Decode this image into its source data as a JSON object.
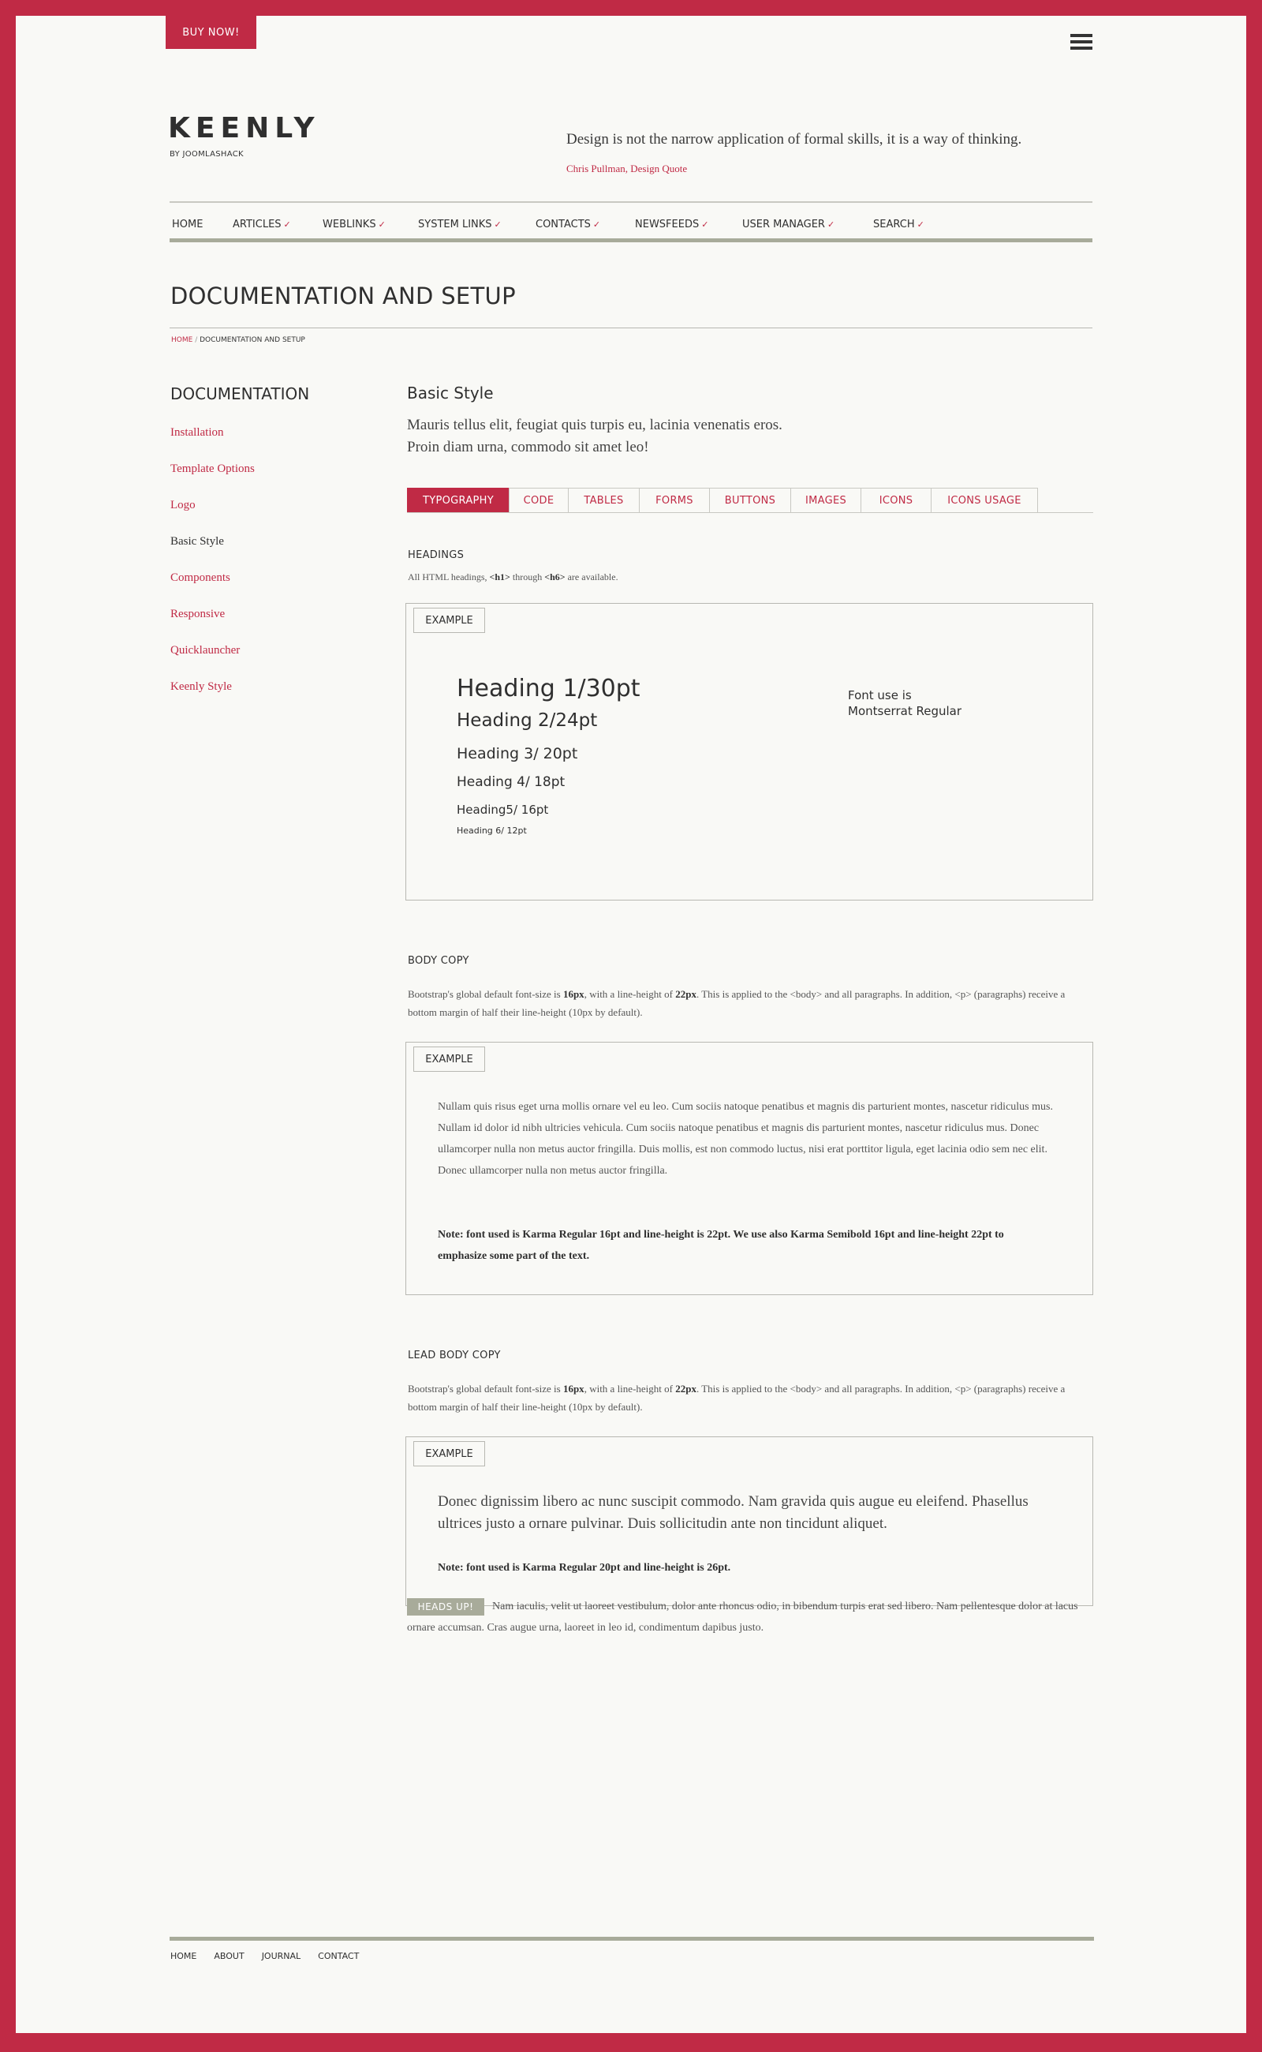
{
  "header": {
    "buy_label": "BUY NOW!",
    "logo": "KEENLY",
    "logo_sub": "BY JOOMLASHACK",
    "quote": "Design is not the narrow application of formal skills, it is a way of thinking.",
    "quote_author": "Chris Pullman, Design Quote"
  },
  "nav": {
    "items": [
      {
        "label": "HOME",
        "dropdown": false
      },
      {
        "label": "ARTICLES",
        "dropdown": true
      },
      {
        "label": "WEBLINKS",
        "dropdown": true
      },
      {
        "label": "SYSTEM LINKS",
        "dropdown": true
      },
      {
        "label": "CONTACTS",
        "dropdown": true
      },
      {
        "label": "NEWSFEEDS",
        "dropdown": true
      },
      {
        "label": "USER MANAGER",
        "dropdown": true
      },
      {
        "label": "SEARCH",
        "dropdown": true
      }
    ]
  },
  "page": {
    "title": "DOCUMENTATION AND SETUP",
    "breadcrumb_home": "HOME",
    "breadcrumb_sep": "/",
    "breadcrumb_current": "DOCUMENTATION AND SETUP"
  },
  "sidebar": {
    "title": "DOCUMENTATION",
    "items": [
      {
        "label": "Installation",
        "active": false
      },
      {
        "label": "Template Options",
        "active": false
      },
      {
        "label": "Logo",
        "active": false
      },
      {
        "label": "Basic Style",
        "active": true
      },
      {
        "label": "Components",
        "active": false
      },
      {
        "label": "Responsive",
        "active": false
      },
      {
        "label": "Quicklauncher",
        "active": false
      },
      {
        "label": "Keenly Style",
        "active": false
      }
    ]
  },
  "main": {
    "heading": "Basic Style",
    "lead_1": "Mauris tellus elit, feugiat quis turpis eu, lacinia venenatis eros.",
    "lead_2": "Proin diam urna, commodo sit amet leo!",
    "tabs": [
      {
        "label": "TYPOGRAPHY",
        "active": true
      },
      {
        "label": "CODE",
        "active": false
      },
      {
        "label": "TABLES",
        "active": false
      },
      {
        "label": "FORMS",
        "active": false
      },
      {
        "label": "BUTTONS",
        "active": false
      },
      {
        "label": "IMAGES",
        "active": false
      },
      {
        "label": "ICONS",
        "active": false
      },
      {
        "label": "ICONS USAGE",
        "active": false
      }
    ],
    "example_label": "EXAMPLE",
    "headings": {
      "label": "HEADINGS",
      "desc_pre": "All HTML headings, ",
      "desc_h1": "<h1>",
      "desc_mid": " through ",
      "desc_h6": "<h6>",
      "desc_post": " are available.",
      "samples": [
        "Heading 1/30pt",
        "Heading 2/24pt",
        "Heading 3/ 20pt",
        "Heading 4/ 18pt",
        "Heading5/ 16pt",
        "Heading 6/ 12pt"
      ],
      "font_note_1": "Font use is",
      "font_note_2": "Montserrat Regular"
    },
    "body_copy": {
      "label": "BODY COPY",
      "desc_1": "Bootstrap's global default font-size is ",
      "desc_16": "16px",
      "desc_2": ", with a line-height of ",
      "desc_22": "22px",
      "desc_3": ". This is applied to the <body> and all paragraphs. In addition, <p> (paragraphs) receive a bottom margin of half their line-height (10px by default).",
      "para": "Nullam quis risus eget urna mollis ornare vel eu leo. Cum sociis natoque penatibus et magnis dis parturient montes, nascetur ridiculus mus. Nullam id dolor id nibh ultricies vehicula. Cum sociis natoque penatibus et magnis dis parturient montes, nascetur ridiculus mus. Donec ullamcorper nulla non metus auctor fringilla. Duis mollis, est non commodo luctus, nisi erat porttitor ligula, eget lacinia odio sem nec elit. Donec ullamcorper nulla non metus auctor fringilla.",
      "note": "Note: font used is Karma Regular 16pt and line-height is 22pt. We use also Karma Semibold 16pt and line-height 22pt to emphasize some part of the text."
    },
    "lead_copy": {
      "label": "LEAD  BODY COPY",
      "lead_para": "Donec dignissim libero ac nunc suscipit commodo. Nam gravida quis augue eu eleifend. Phasellus ultrices justo a ornare pulvinar. Duis sollicitudin ante non tincidunt aliquet.",
      "note": "Note: font used is Karma Regular 20pt and line-height is 26pt."
    },
    "heads_up": {
      "badge": "HEADS UP!",
      "text": "Nam iaculis, velit ut laoreet vestibulum, dolor ante rhoncus odio, in bibendum turpis erat sed libero. Nam pellentesque dolor at lacus ornare accumsan. Cras augue urna, laoreet in leo id, condimentum dapibus justo."
    }
  },
  "footer": {
    "items": [
      "HOME",
      "ABOUT",
      "JOURNAL",
      "CONTACT"
    ]
  },
  "colors": {
    "brand": "#c02a45",
    "background": "#f9f9f6",
    "rule": "#a8ab9a"
  }
}
